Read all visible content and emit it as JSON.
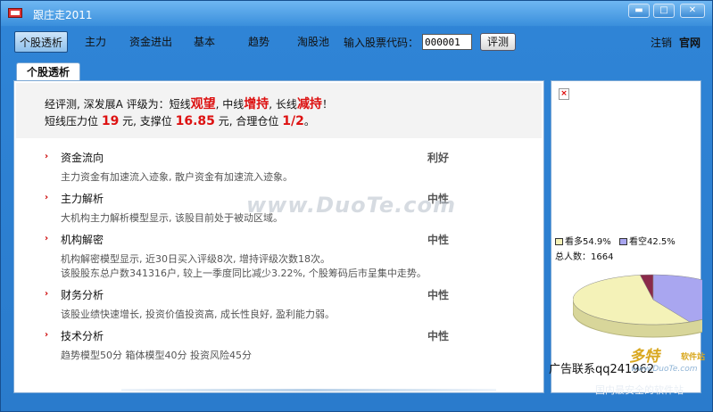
{
  "window": {
    "title": "跟庄走2011",
    "controls": {
      "minimize": "▬",
      "maximize": "□",
      "close": "✕"
    }
  },
  "menu": {
    "items": [
      "个股透析",
      "主力",
      "资金进出",
      "基本",
      "趋势",
      "淘股池"
    ],
    "active_index": 0,
    "stock_code_label": "输入股票代码：",
    "stock_code_value": "000001",
    "evaluate_button": "评测",
    "logout": "注销",
    "official_site": "官网"
  },
  "tab": {
    "label": "个股透析"
  },
  "summary": {
    "line1_prefix": "经评测, 深发展A 评级为：短线",
    "short_rating": "观望",
    "mid_prefix": ", 中线",
    "mid_rating": "增持",
    "long_prefix": ", 长线",
    "long_rating": "减持",
    "line1_suffix": "！",
    "pressure_prefix": "短线压力位",
    "pressure_value": "19",
    "support_prefix": "元, 支撑位",
    "support_value": "16.85",
    "position_prefix": "元, 合理仓位",
    "position_value": "1/2",
    "line2_suffix": "。"
  },
  "sections": [
    {
      "title": "资金流向",
      "rating": "利好",
      "lines": [
        "主力资金有加速流入迹象, 散户资金有加速流入迹象。"
      ]
    },
    {
      "title": "主力解析",
      "rating": "中性",
      "lines": [
        "大机构主力解析模型显示, 该股目前处于被动区域。"
      ]
    },
    {
      "title": "机构解密",
      "rating": "中性",
      "lines": [
        "机构解密模型显示, 近30日买入评级8次, 增持评级次数18次。",
        "该股股东总户数341316户, 较上一季度同比减少3.22%, 个股筹码后市呈集中走势。"
      ]
    },
    {
      "title": "财务分析",
      "rating": "中性",
      "lines": [
        "该股业绩快速增长, 投资价值投资高, 成长性良好, 盈利能力弱。"
      ]
    },
    {
      "title": "技术分析",
      "rating": "中性",
      "lines": [
        "趋势模型50分  箱体模型40分  投资风险45分"
      ]
    }
  ],
  "watermark": "www.DuoTe.com",
  "sidebar": {
    "broken_image": "×",
    "legend": [
      {
        "label": "看多54.9%",
        "color": "#f4f2b8"
      },
      {
        "label": "看空42.5%",
        "color": "#a9a6f0"
      }
    ],
    "count_label": "总人数：1664",
    "ad_text": "广告联系qq241962",
    "chart_colors": {
      "bull": "#f4f2b8",
      "bear": "#a9a6f0",
      "other": "#8a2a4a"
    }
  },
  "chart_data": {
    "type": "pie",
    "labels": [
      "看多",
      "看空"
    ],
    "values": [
      54.9,
      42.5
    ],
    "total": 1664
  },
  "logo": {
    "name": "多特",
    "sub": "软件站",
    "url": "www.DuoTe.com",
    "slogan": "国内最安全的软件站"
  }
}
